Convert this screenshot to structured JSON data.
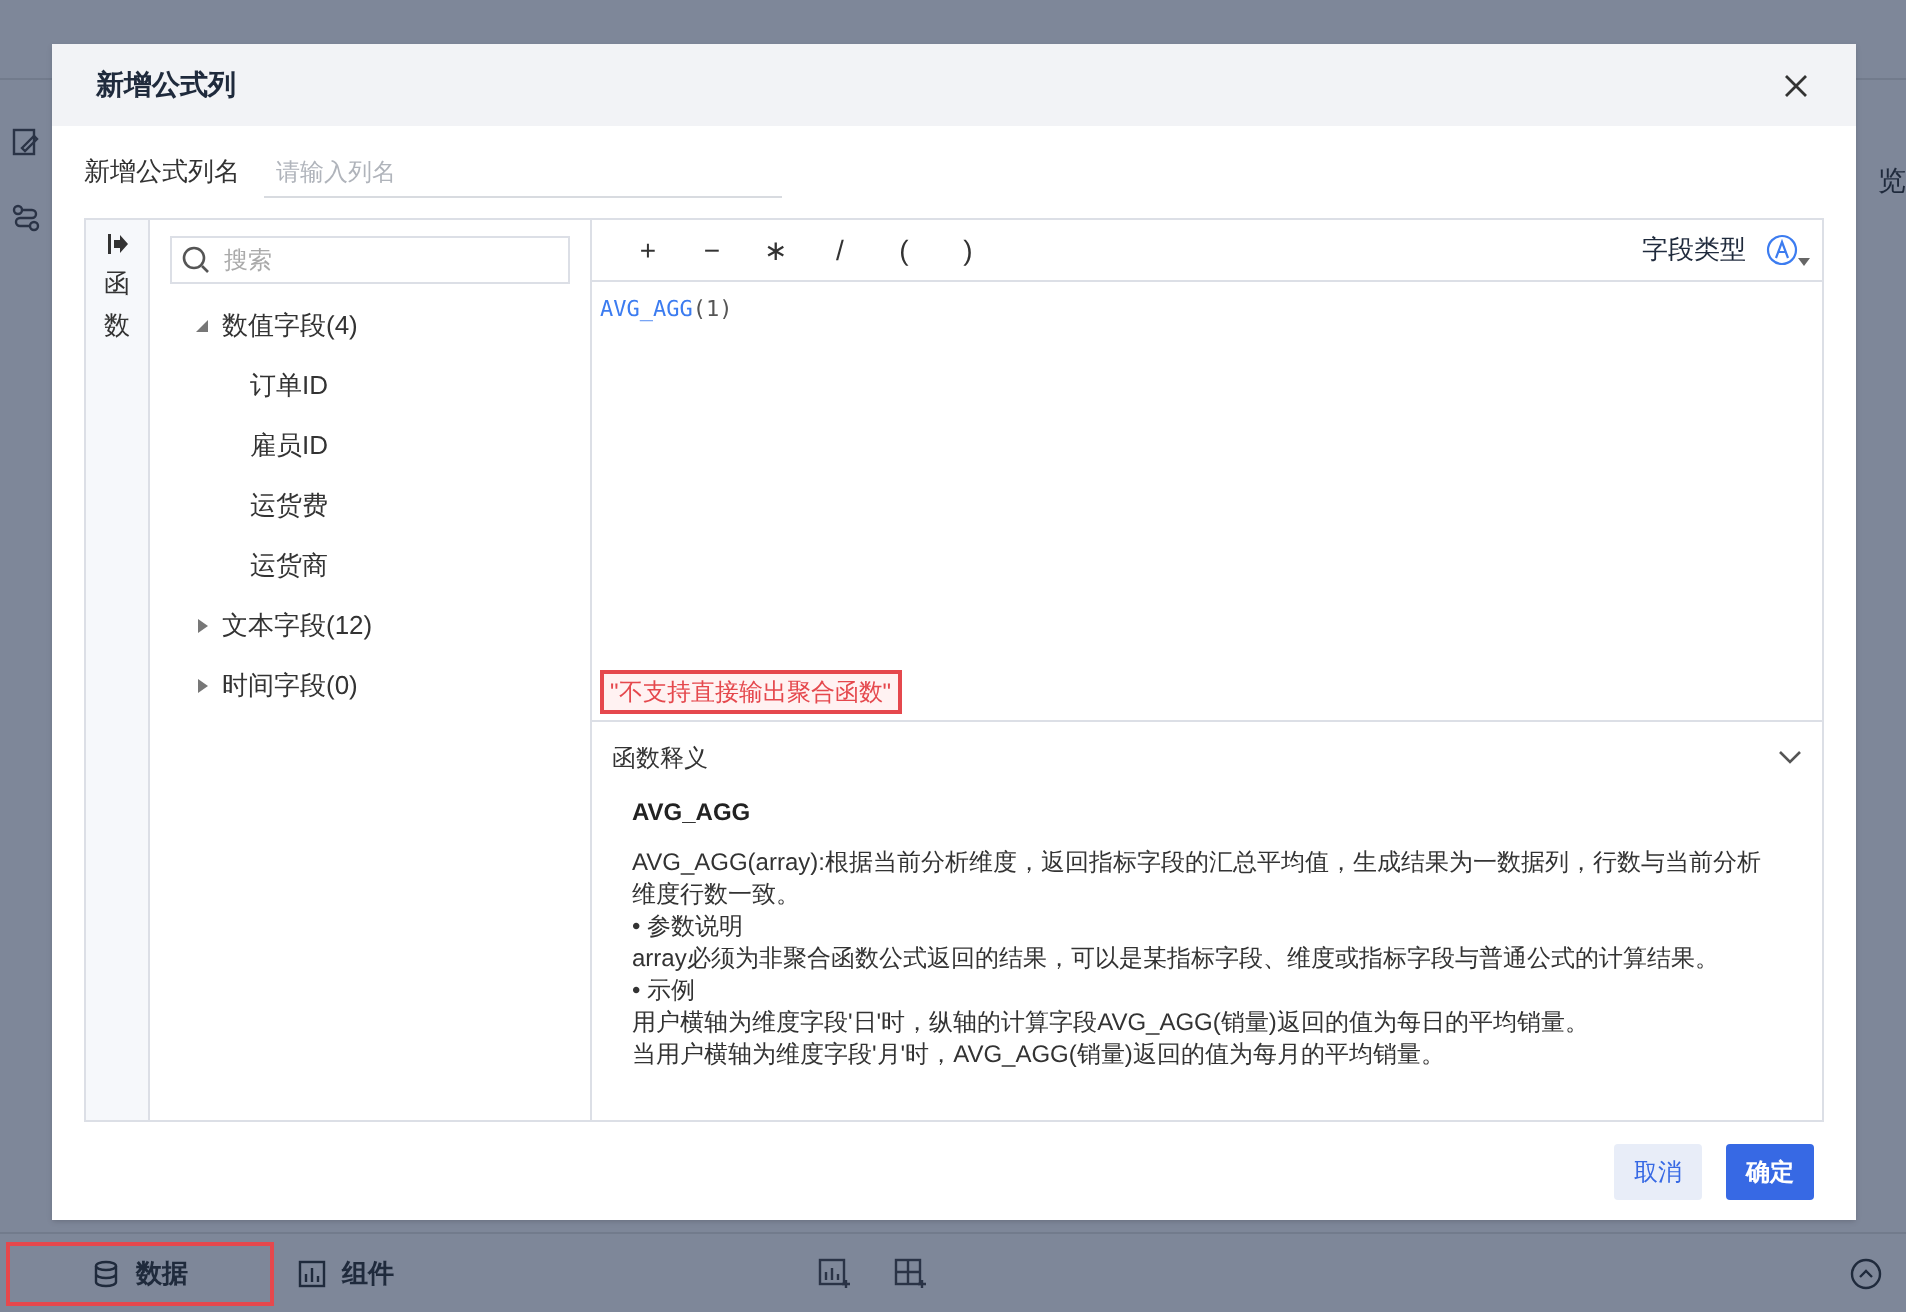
{
  "background": {
    "side_label": "览",
    "bottom_tabs": [
      {
        "label": "数据",
        "selected": true,
        "kind": "data"
      },
      {
        "label": "组件",
        "selected": false,
        "kind": "chart"
      }
    ]
  },
  "dialog": {
    "title": "新增公式列",
    "name_label": "新增公式列名",
    "name_placeholder": "请输入列名",
    "side_tab": {
      "label": "函数"
    },
    "search": {
      "placeholder": "搜索"
    },
    "tree": [
      {
        "label": "数值字段(4)",
        "expanded": true,
        "children": [
          {
            "label": "订单ID"
          },
          {
            "label": "雇员ID"
          },
          {
            "label": "运货费"
          },
          {
            "label": "运货商"
          }
        ]
      },
      {
        "label": "文本字段(12)",
        "expanded": false
      },
      {
        "label": "时间字段(0)",
        "expanded": false
      }
    ],
    "operators": [
      "+",
      "−",
      "∗",
      "/",
      "(",
      ")"
    ],
    "field_type_label": "字段类型",
    "formula": {
      "name": "AVG_AGG",
      "args": "(1)"
    },
    "error": "\"不支持直接输出聚合函数\"",
    "help": {
      "title": "函数释义",
      "expanded": true,
      "heading": "AVG_AGG",
      "lines": [
        "AVG_AGG(array):根据当前分析维度，返回指标字段的汇总平均值，生成结果为一数据列，行数与当前分析维度行数一致。",
        "• 参数说明",
        "array必须为非聚合函数公式返回的结果，可以是某指标字段、维度或指标字段与普通公式的计算结果。",
        "• 示例",
        "用户横轴为维度字段'日'时，纵轴的计算字段AVG_AGG(销量)返回的值为每日的平均销量。",
        "当用户横轴为维度字段'月'时，AVG_AGG(销量)返回的值为每月的平均销量。"
      ]
    },
    "buttons": [
      {
        "label": "取消",
        "kind": "secondary"
      },
      {
        "label": "确定",
        "kind": "primary"
      }
    ]
  }
}
